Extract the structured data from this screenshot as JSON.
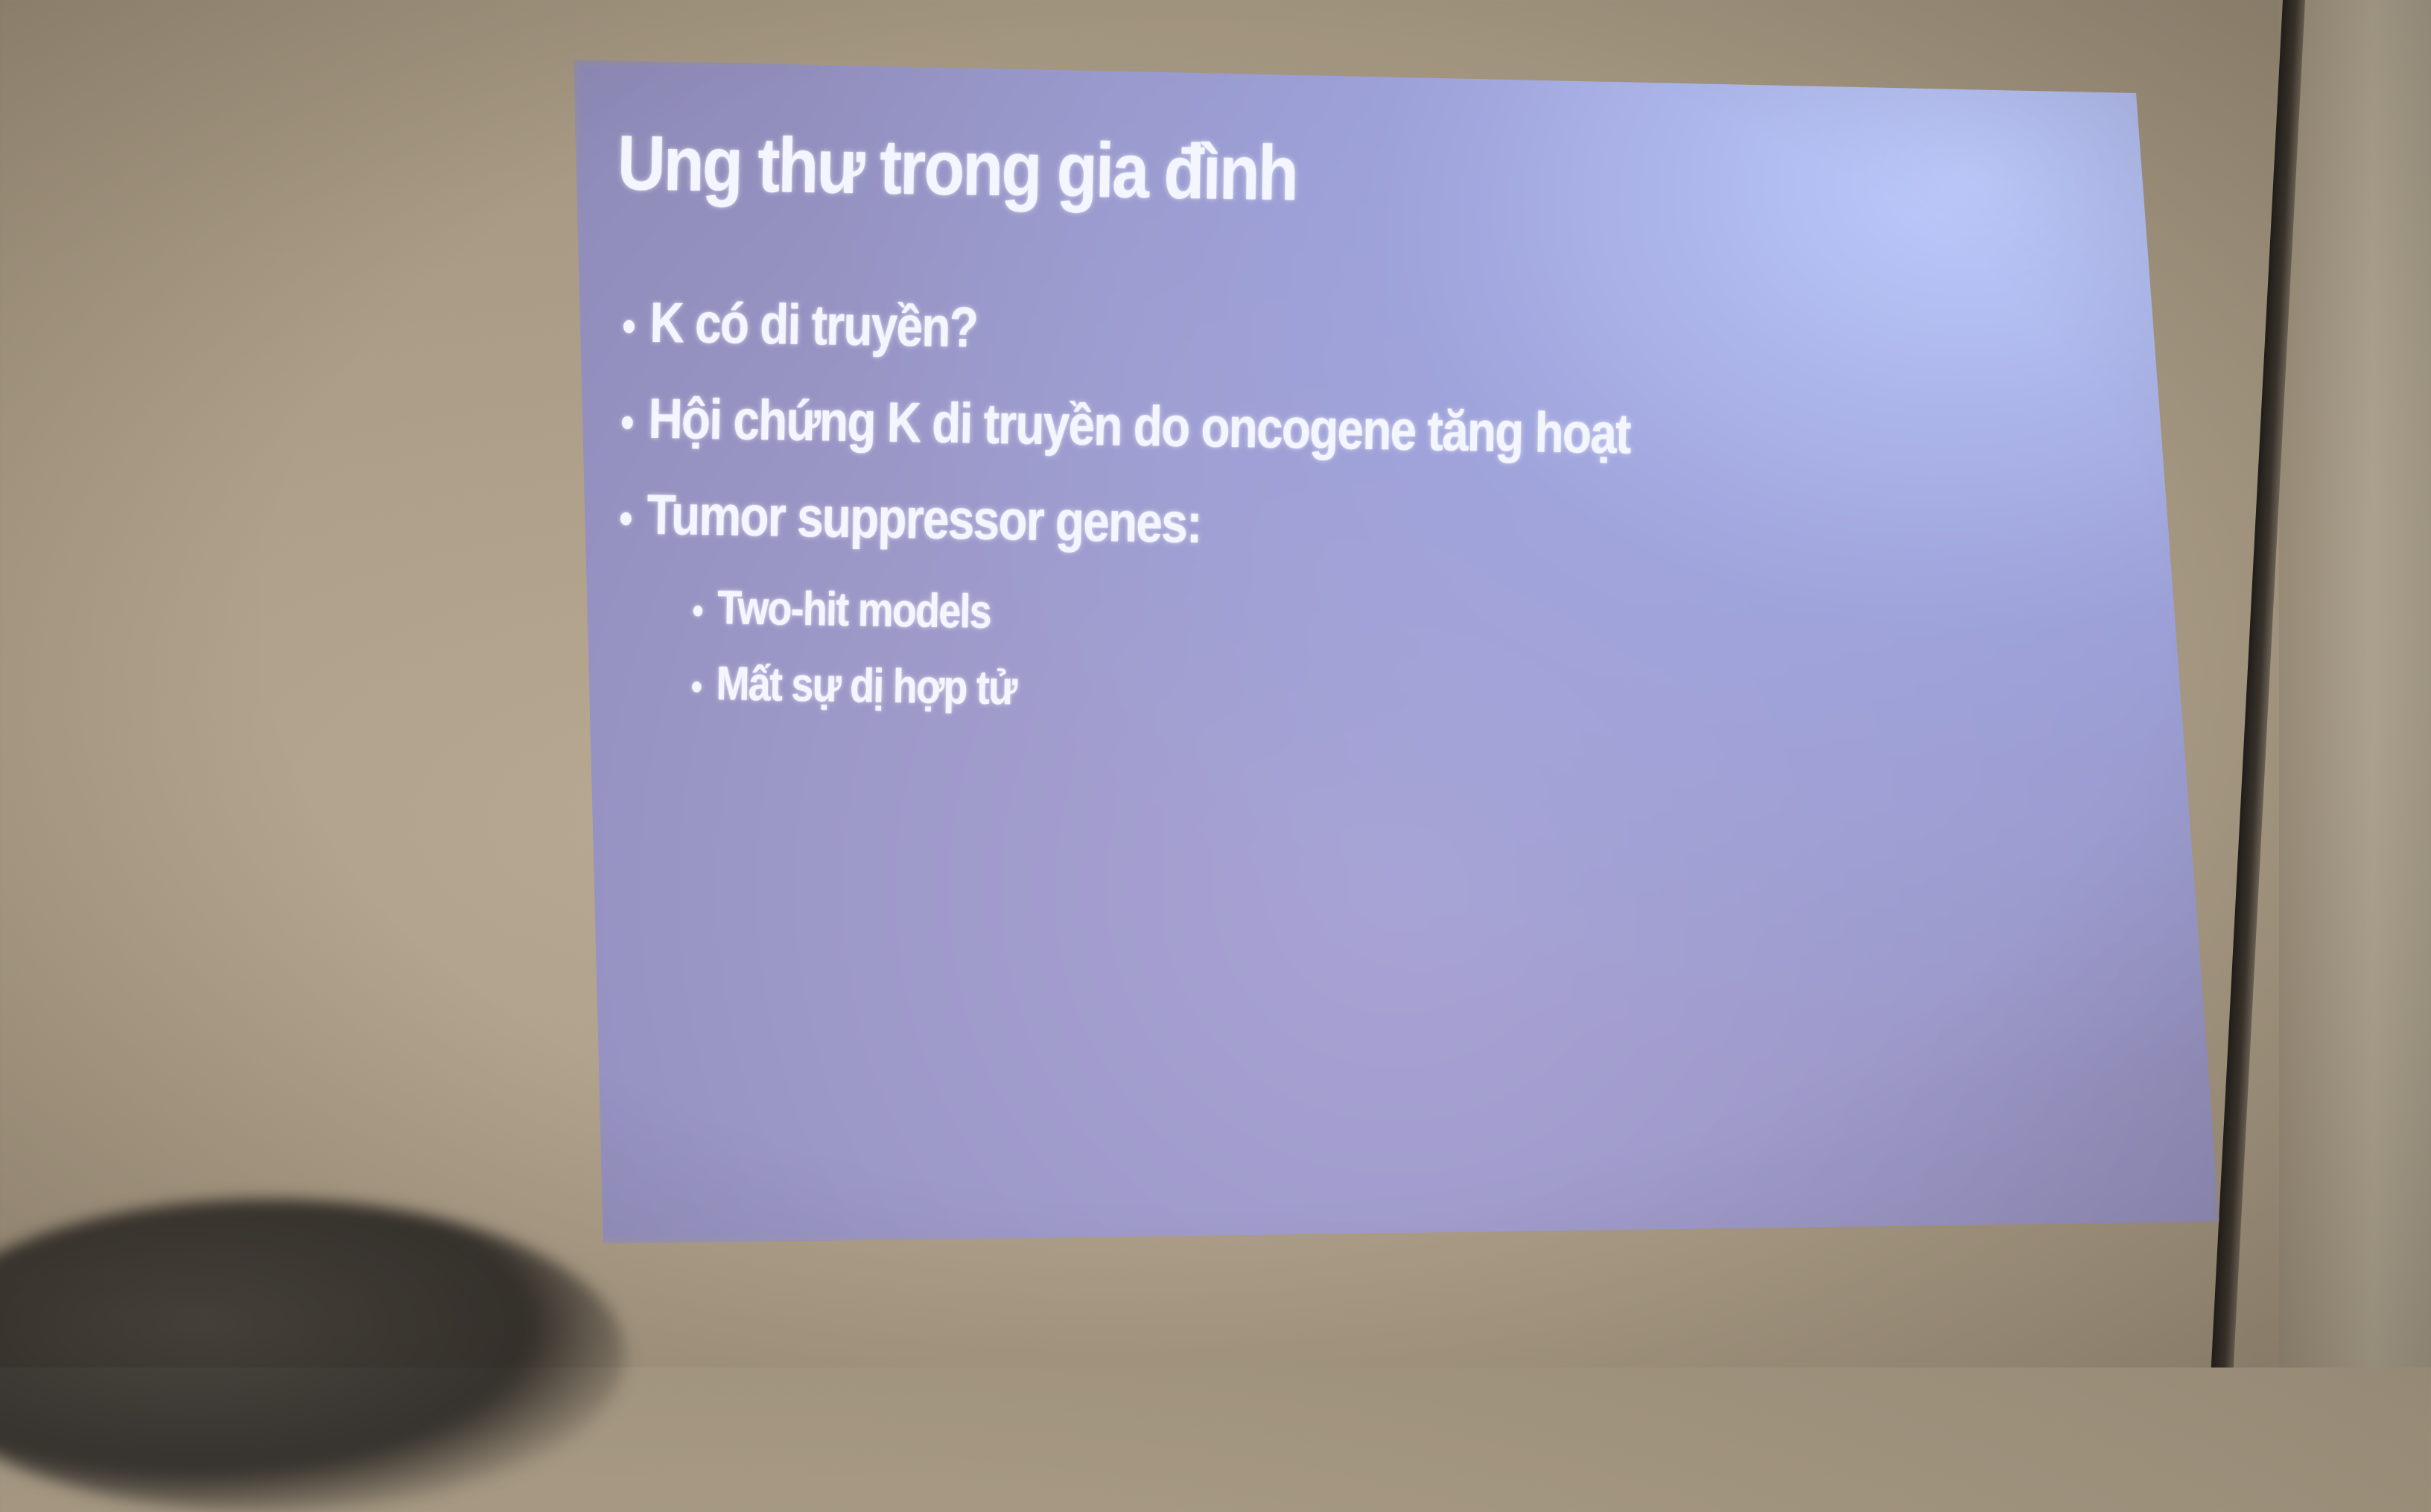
{
  "slide": {
    "title": "Ung thư trong gia đình",
    "bullets": [
      "K có di truyền?",
      "Hội chứng K di truyền do oncogene tăng hoạt",
      "Tumor suppressor genes:"
    ],
    "sub_bullets": [
      "Two-hit models",
      "Mất sự dị hợp tử"
    ],
    "bullet_symbol": "•"
  },
  "colors": {
    "slide_background": "#a8a3d4",
    "slide_highlight": "#bccdff",
    "text": "#f4f6ff",
    "wall": "#b7a891"
  }
}
